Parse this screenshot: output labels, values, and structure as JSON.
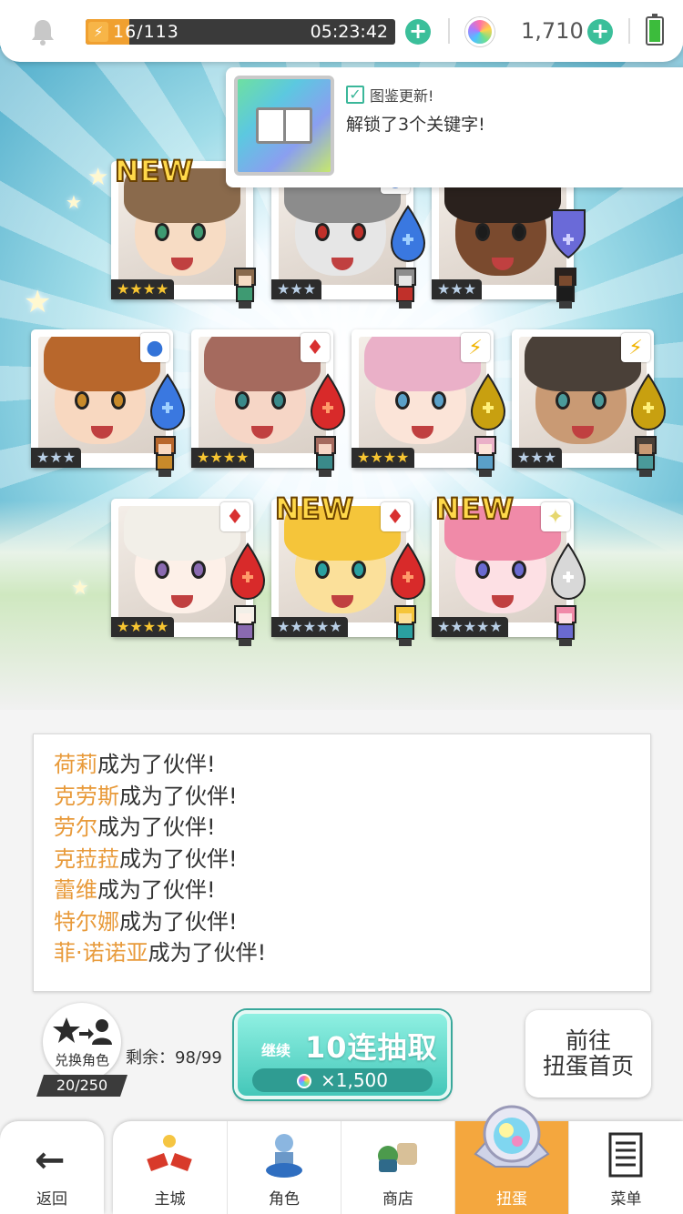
{
  "topbar": {
    "stamina": "16/113",
    "stamina_fraction": 0.14,
    "timer": "05:23:42",
    "gems": "1,710",
    "bolt_glyph": "⚡",
    "plus_glyph": "+"
  },
  "popup": {
    "title": "图鉴更新!",
    "message": "解锁了3个关键字!"
  },
  "cards": [
    {
      "rarity": "★★★★",
      "rarity_tier": "gold",
      "new": true,
      "new_label": "NEW",
      "element": "none",
      "skin": "#f7dcc4",
      "hair": "#8a6a4c",
      "eye": "#3e9a72"
    },
    {
      "rarity": "★★★",
      "rarity_tier": "silver",
      "new": false,
      "element": "water",
      "skin": "#e6e6e6",
      "hair": "#8c8c8c",
      "eye": "#c0302a"
    },
    {
      "rarity": "★★★",
      "rarity_tier": "silver",
      "new": false,
      "element": "shield",
      "skin": "#7a4a2e",
      "hair": "#2a211d",
      "eye": "#1c1c1c"
    },
    {
      "rarity": "★★★",
      "rarity_tier": "silver",
      "new": false,
      "element": "water",
      "skin": "#f8d8c0",
      "hair": "#b8672c",
      "eye": "#c88a2a"
    },
    {
      "rarity": "★★★★",
      "rarity_tier": "gold",
      "new": false,
      "element": "fire",
      "skin": "#f6d6c6",
      "hair": "#a56a5e",
      "eye": "#3a8a8a"
    },
    {
      "rarity": "★★★★",
      "rarity_tier": "gold",
      "new": false,
      "element": "thunder",
      "skin": "#fbe4d8",
      "hair": "#eab0c8",
      "eye": "#5aa0c8"
    },
    {
      "rarity": "★★★",
      "rarity_tier": "silver",
      "new": false,
      "element": "thunder",
      "skin": "#c99a74",
      "hair": "#4a4038",
      "eye": "#4a9a9a"
    },
    {
      "rarity": "★★★★",
      "rarity_tier": "gold",
      "new": false,
      "element": "fire",
      "skin": "#fdf0e8",
      "hair": "#f2efe8",
      "eye": "#8a6ab0"
    },
    {
      "rarity": "★★★★★",
      "rarity_tier": "silver",
      "new": true,
      "new_label": "NEW",
      "element": "fire",
      "skin": "#fbe09a",
      "hair": "#f5c53a",
      "eye": "#2aa0a0"
    },
    {
      "rarity": "★★★★★",
      "rarity_tier": "silver",
      "new": true,
      "new_label": "NEW",
      "element": "light",
      "skin": "#fde0e4",
      "hair": "#f08aa8",
      "eye": "#6a6ad0"
    }
  ],
  "log": {
    "suffix": "成为了伙伴!",
    "names": [
      "荷莉",
      "克劳斯",
      "劳尔",
      "克菈菈",
      "蕾维",
      "特尔娜",
      "菲·诺诺亚"
    ]
  },
  "actions": {
    "exchange_label": "兑换角色",
    "exchange_count": "20/250",
    "remain_text": "剩余：98/99",
    "pull_small": "继续",
    "pull_main": "10连抽取",
    "pull_cost": "×1,500",
    "goto_line1": "前往",
    "goto_line2": "扭蛋首页"
  },
  "nav": {
    "back": "返回",
    "items": [
      "主城",
      "角色",
      "商店",
      "扭蛋",
      "菜单"
    ],
    "active_index": 3
  },
  "colors": {
    "accent_orange": "#f4a73e",
    "teal_button": "#44c7b9",
    "name_highlight": "#e89a3a",
    "plus_green": "#3bbf9a"
  }
}
